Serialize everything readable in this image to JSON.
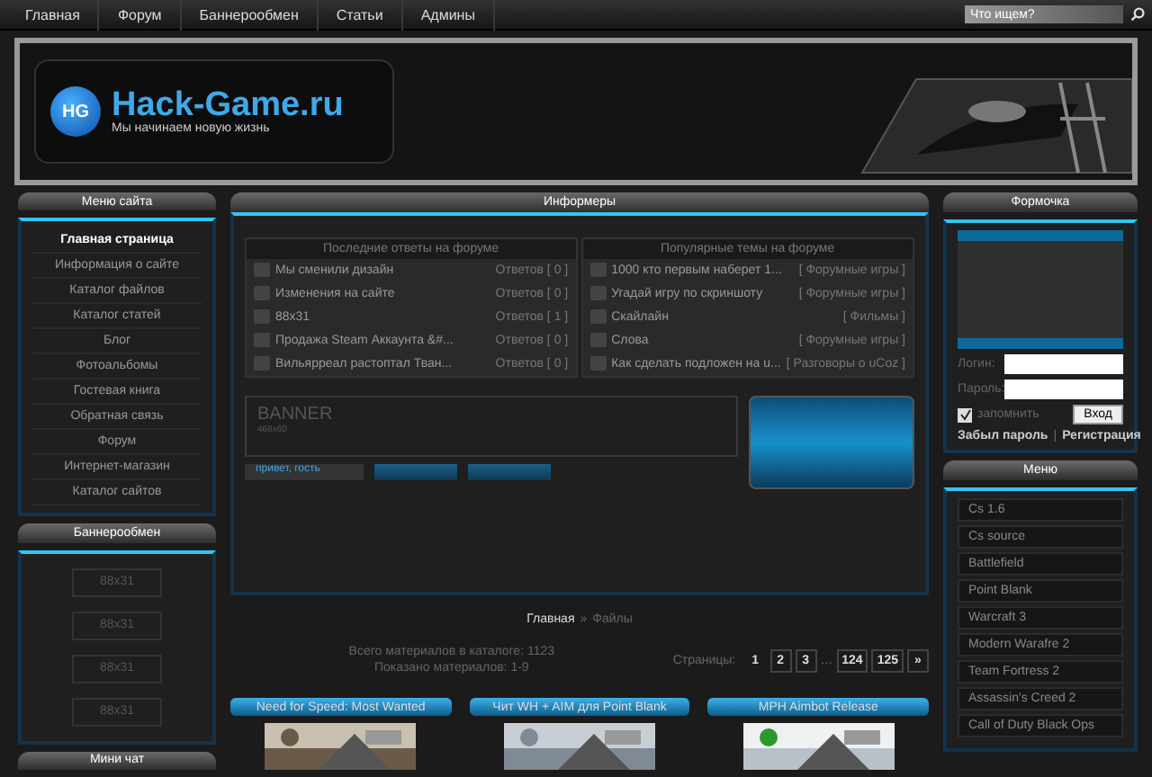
{
  "nav": {
    "items": [
      "Главная",
      "Форум",
      "Баннерообмен",
      "Статьи",
      "Админы"
    ],
    "search": {
      "placeholder": "Что ищем?"
    }
  },
  "header": {
    "logo_badge": "HG",
    "logo": "Hack-Game.ru",
    "slogan": "Мы начинаем новую жизнь"
  },
  "left": {
    "menu_title": "Меню сайта",
    "menu": [
      {
        "label": "Главная страница",
        "selected": true
      },
      {
        "label": "Информация о сайте",
        "selected": false
      },
      {
        "label": "Каталог файлов",
        "selected": false
      },
      {
        "label": "Каталог статей",
        "selected": false
      },
      {
        "label": "Блог",
        "selected": false
      },
      {
        "label": "Фотоальбомы",
        "selected": false
      },
      {
        "label": "Гостевая книга",
        "selected": false
      },
      {
        "label": "Обратная связь",
        "selected": false
      },
      {
        "label": "Форум",
        "selected": false
      },
      {
        "label": "Интернет-магазин",
        "selected": false
      },
      {
        "label": "Каталог сайтов",
        "selected": false
      }
    ],
    "banner_title": "Баннерообмен",
    "banners": [
      "88x31",
      "88x31",
      "88x31",
      "88x31"
    ],
    "chat_title": "Мини чат"
  },
  "informers": {
    "title": "Информеры",
    "forum_tables": [
      {
        "title": "Последние ответы на форуме",
        "rows": [
          {
            "topic": "Мы сменили дизайн",
            "info": "Ответов [ 0 ]"
          },
          {
            "topic": "Изменения на сайте",
            "info": "Ответов [ 0 ]"
          },
          {
            "topic": "88x31",
            "info": "Ответов [ 1 ]"
          },
          {
            "topic": "Продажа Steam Аккаунта &#...",
            "info": "Ответов [ 0 ]"
          },
          {
            "topic": "Вильярреал растоптал Тван...",
            "info": "Ответов [ 0 ]"
          }
        ]
      },
      {
        "title": "Популярные темы на форуме",
        "rows": [
          {
            "topic": "1000 кто первым наберет 1...",
            "info": "[ Форумные игры ]"
          },
          {
            "topic": "Угадай игру по скриншоту",
            "info": "[ Форумные игры ]"
          },
          {
            "topic": "Скайлайн",
            "info": "[ Фильмы ]"
          },
          {
            "topic": "Слова",
            "info": "[ Форумные игры ]"
          },
          {
            "topic": "Как сделать подложен на u...",
            "info": "[ Разговоры о uCoz ]"
          }
        ]
      }
    ],
    "banner": {
      "title": "BANNER",
      "size": "468x60"
    },
    "greeting": "привет, гость"
  },
  "breadcrumb": {
    "home": "Главная",
    "separator": "»",
    "current": "Файлы"
  },
  "stats": [
    "Всего материалов в каталоге: 1123",
    "Показано материалов: 1-9"
  ],
  "pagination": {
    "label": "Страницы:",
    "pages": [
      {
        "label": "1",
        "selected": true
      },
      {
        "label": "2",
        "selected": false
      },
      {
        "label": "3",
        "selected": false
      },
      {
        "label": "…",
        "kind": "gap"
      },
      {
        "label": "124",
        "selected": false
      },
      {
        "label": "125",
        "selected": false
      },
      {
        "label": "»",
        "selected": false
      }
    ]
  },
  "cards": [
    "Need for Speed: Most Wanted",
    "Чит WH + AIM для Point Blank",
    "MPH Aimbot Release"
  ],
  "login": {
    "title": "Формочка",
    "login_label": "Логин:",
    "password_label": "Пароль:",
    "remember": "запомнить",
    "remember_checked": true,
    "submit": "Вход",
    "forgot": "Забыл пароль",
    "separator": "|",
    "register": "Регистрация"
  },
  "right_menu": {
    "title": "Меню",
    "items": [
      "Cs 1.6",
      "Cs source",
      "Battlefield",
      "Point Blank",
      "Warcraft 3",
      "Modern Warafre 2",
      "Team Fortress 2",
      "Assassin's Creed 2",
      "Call of Duty Black Ops"
    ]
  }
}
